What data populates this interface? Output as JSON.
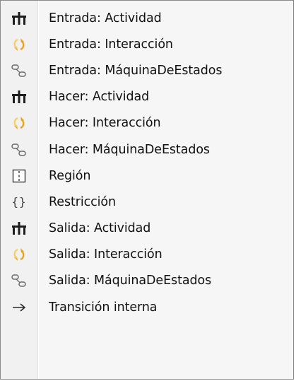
{
  "menu": {
    "items": [
      {
        "label": "Entrada: Actividad",
        "icon": "activity-icon"
      },
      {
        "label": "Entrada: Interacción",
        "icon": "interaction-icon"
      },
      {
        "label": "Entrada: MáquinaDeEstados",
        "icon": "state-machine-icon"
      },
      {
        "label": "Hacer: Actividad",
        "icon": "activity-icon"
      },
      {
        "label": "Hacer: Interacción",
        "icon": "interaction-icon"
      },
      {
        "label": "Hacer: MáquinaDeEstados",
        "icon": "state-machine-icon"
      },
      {
        "label": "Región",
        "icon": "region-icon"
      },
      {
        "label": "Restricción",
        "icon": "constraint-icon",
        "glyph": "{}"
      },
      {
        "label": "Salida: Actividad",
        "icon": "activity-icon"
      },
      {
        "label": "Salida: Interacción",
        "icon": "interaction-icon"
      },
      {
        "label": "Salida: MáquinaDeEstados",
        "icon": "state-machine-icon"
      },
      {
        "label": "Transición interna",
        "icon": "arrow-right-icon"
      }
    ]
  },
  "colors": {
    "interaction_orange": "#e8a320",
    "interaction_light": "#f7cf6a",
    "icon_dark": "#1e1e1e",
    "state_gray": "#6a6a6a"
  }
}
